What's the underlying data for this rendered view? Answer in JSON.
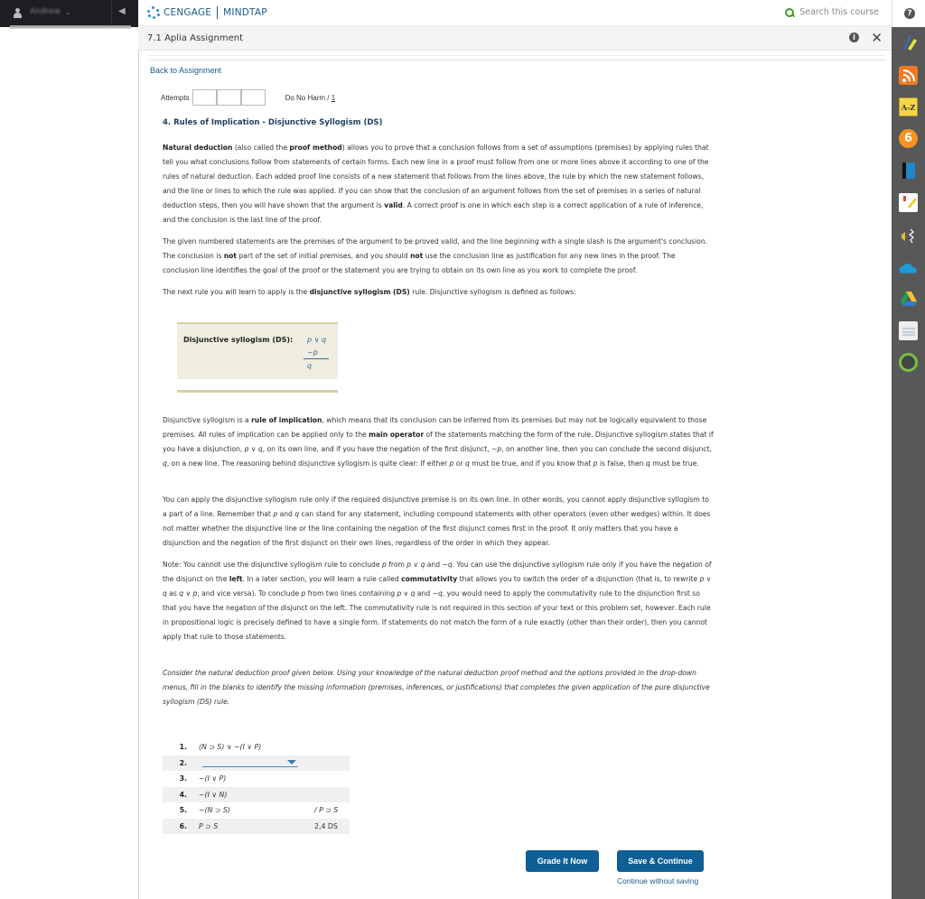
{
  "user": {
    "name": "Andrew",
    "icon": "user-icon",
    "caret_icon": "chevron-down-icon",
    "collapse_icon": "collapse-icon"
  },
  "header": {
    "brand": "CENGAGE",
    "product": "MINDTAP",
    "search_placeholder": "Search this course",
    "help_icon": "help-icon"
  },
  "titlebar": {
    "title": "7.1 Aplia Assignment",
    "info_icon": "info-icon",
    "close_label": "✕"
  },
  "right_tools": [
    {
      "name": "highlighter-tool",
      "icon": "pen-highlighter-icon"
    },
    {
      "name": "rss-tool",
      "icon": "rss-icon"
    },
    {
      "name": "glossary-tool",
      "icon": "a-z-icon",
      "label": "A-Z"
    },
    {
      "name": "app-six-tool",
      "icon": "six-icon",
      "label": "6"
    },
    {
      "name": "ebook-tool",
      "icon": "book-icon"
    },
    {
      "name": "notes-tool",
      "icon": "notebook-icon"
    },
    {
      "name": "readspeaker-tool",
      "icon": "audio-icon"
    },
    {
      "name": "onedrive-tool",
      "icon": "cloud-icon"
    },
    {
      "name": "google-drive-tool",
      "icon": "drive-icon"
    },
    {
      "name": "flashcards-tool",
      "icon": "flashcards-icon"
    },
    {
      "name": "progress-tool",
      "icon": "avatar-progress-icon"
    }
  ],
  "content": {
    "back_link": "Back to Assignment",
    "attempts_label": "Attempts",
    "do_no_harm": "Do No Harm / ",
    "do_no_harm_count": "1",
    "question_title": "4. Rules of Implication - Disjunctive Syllogism (DS)",
    "p1": {
      "b1": "Natural deduction",
      "t1": " (also called the ",
      "b2": "proof method",
      "t2": ") allows you to prove that a conclusion follows from a set of assumptions (premises) by applying rules that tell you what conclusions follow from statements of certain forms. Each new line in a proof must follow from one or more lines above it according to one of the rules of natural deduction. Each added proof line consists of a new statement that follows from the lines above, the rule by which the new statement follows, and the line or lines to which the rule was applied. If you can show that the conclusion of an argument follows from the set of premises in a series of natural deduction steps, then you will have shown that the argument is ",
      "b3": "valid",
      "t3": ". A correct proof is one in which each step is a correct application of a rule of inference, and the conclusion is the last line of the proof."
    },
    "p2": {
      "t1": "The given numbered statements are the premises of the argument to be proved valid, and the line beginning with a single slash is the argument's conclusion. The conclusion is ",
      "b1": "not",
      "t2": " part of the set of initial premises, and you should ",
      "b2": "not",
      "t3": " use the conclusion line as justification for any new lines in the proof. The conclusion line identifies the goal of the proof or the statement you are trying to obtain on its own line as you work to complete the proof."
    },
    "p3": {
      "t1": "The next rule you will learn to apply is the ",
      "b1": "disjunctive syllogism (DS)",
      "t2": " rule. Disjunctive syllogism is defined as follows:"
    },
    "ds_box": {
      "label": "Disjunctive syllogism (DS):",
      "line1": "p ∨ q",
      "line2": "~p",
      "line3": "q"
    },
    "p4": {
      "t1": "Disjunctive syllogism is a ",
      "b1": "rule of implication",
      "t2": ", which means that its conclusion can be inferred from its premises but may not be logically equivalent to those premises. All rules of implication can be applied only to the ",
      "b2": "main operator",
      "t3": " of the statements matching the form of the rule. Disjunctive syllogism states that if you have a disjunction, ",
      "i1": "p ∨ q",
      "t4": ", on its own line, and if you have the negation of the first disjunct, ",
      "i2": "~p",
      "t5": ", on another line, then you can conclude the second disjunct, ",
      "i3": "q",
      "t6": ", on a new line. The reasoning behind disjunctive syllogism is quite clear: If either ",
      "i4": "p",
      "t7": " or ",
      "i5": "q",
      "t8": " must be true, and if you know that ",
      "i6": "p",
      "t9": " is false, then ",
      "i7": "q",
      "t10": " must be true."
    },
    "p5": {
      "t1": "You can apply the disjunctive syllogism rule only if the required disjunctive premise is on its own line. In other words, you cannot apply disjunctive syllogism to a part of a line. Remember that ",
      "i1": "p",
      "t2": " and ",
      "i2": "q",
      "t3": " can stand for any statement, including compound statements with other operators (even other wedges) within. It does not matter whether the disjunctive line or the line containing the negation of the first disjunct comes first in the proof. It only matters that you have a disjunction and the negation of the first disjunct on their own lines, regardless of the order in which they appear."
    },
    "p6": {
      "t1": "Note: You cannot use the disjunctive syllogism rule to conclude ",
      "i1": "p",
      "t2": " from ",
      "i2": "p ∨ q",
      "t3": " and ",
      "i3": "~q",
      "t4": ". You can use the disjunctive syllogism rule only if you have the negation of the disjunct on the ",
      "b1": "left",
      "t5": ". In a later section, you will learn a rule called ",
      "b2": "commutativity",
      "t6": " that allows you to switch the order of a disjunction (that is, to rewrite ",
      "i4": "p ∨ q",
      "t7": " as ",
      "i5": "q ∨ p",
      "t8": ", and vice versa). To conclude ",
      "i6": "p",
      "t9": " from two lines containing ",
      "i7": "p ∨ q",
      "t10": " and ",
      "i8": "~q",
      "t11": ", you would need to apply the commutativity rule to the disjunction first so that you have the negation of the disjunct on the left. The commutativity rule is not required in this section of your text or this problem set, however. Each rule in propositional logic is precisely defined to have a single form. If statements do not match the form of a rule exactly (other than their order), then you cannot apply that rule to those statements."
    },
    "instructions": "Consider the natural deduction proof given below. Using your knowledge of the natural deduction proof method and the options provided in the drop-down menus, fill in the blanks to identify the missing information (premises, inferences, or justifications) that completes the given application of the pure disjunctive syllogism (DS) rule.",
    "proof": [
      {
        "num": "1.",
        "stmt": "(N ⊃ S) ∨ ~(I ∨ P)",
        "just": ""
      },
      {
        "num": "2.",
        "stmt": "",
        "just": "",
        "dropdown": true,
        "dropdown_value": ""
      },
      {
        "num": "3.",
        "stmt": "~(I ∨ P)",
        "just": ""
      },
      {
        "num": "4.",
        "stmt": "~(I ∨ N)",
        "just": ""
      },
      {
        "num": "5.",
        "stmt": "~(N ⊃ S)",
        "just": "/ P ⊃ S"
      },
      {
        "num": "6.",
        "stmt": "P ⊃ S",
        "just": "2,4 DS"
      }
    ]
  },
  "actions": {
    "grade": "Grade It Now",
    "save": "Save & Continue",
    "continue_without_saving": "Continue without saving"
  },
  "colors": {
    "brand_blue": "#0e5f95",
    "link_blue": "#1a5c8a",
    "search_green": "#3f9c2a",
    "ds_box_bg": "#eeede0",
    "sidebar_bg": "#585858"
  }
}
